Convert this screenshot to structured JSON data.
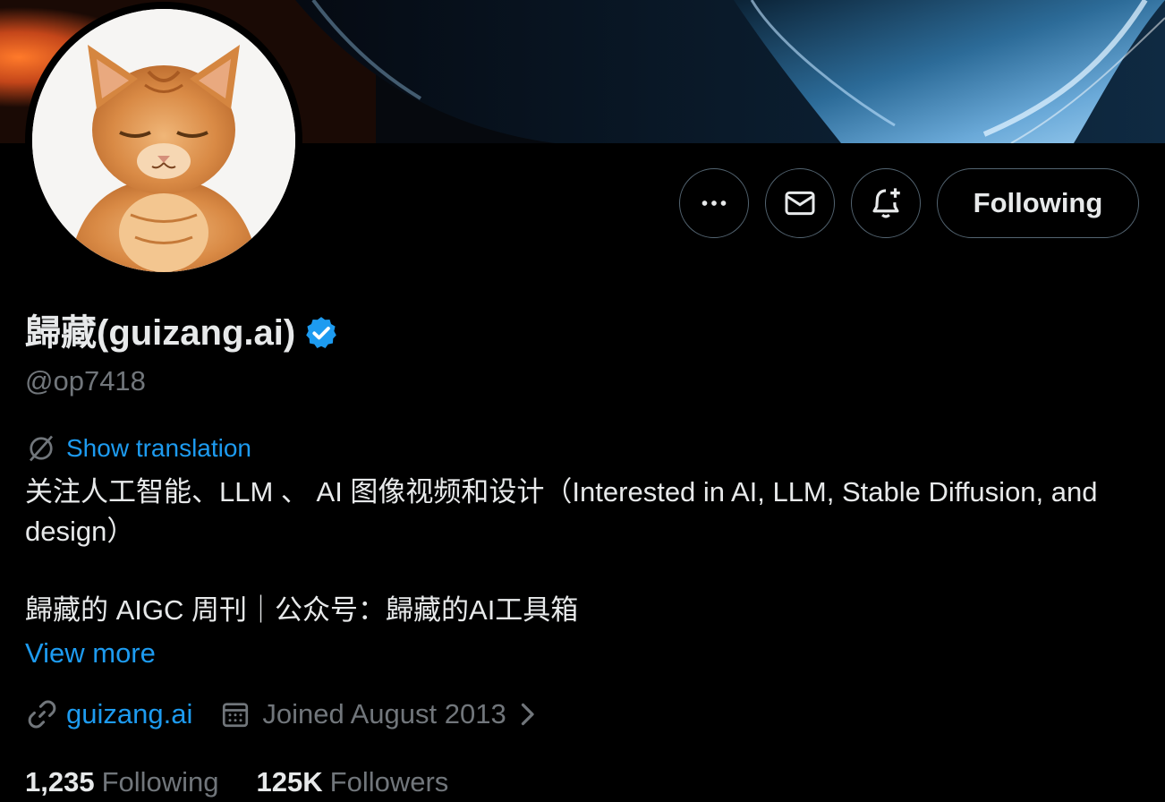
{
  "profile": {
    "display_name": "歸藏(guizang.ai)",
    "handle": "@op7418",
    "verified_icon": "verified-badge-icon",
    "verified_color": "#1d9bf0"
  },
  "actions": {
    "more_icon": "more-horizontal-icon",
    "message_icon": "mail-icon",
    "notify_icon": "bell-plus-icon",
    "following_label": "Following"
  },
  "translation": {
    "icon": "translate-icon",
    "label": "Show translation"
  },
  "bio": {
    "line1": "关注人工智能、LLM 、 AI 图像视频和设计（Interested in AI, LLM, Stable Diffusion, and design）",
    "line2": "歸藏的 AIGC 周刊｜公众号：歸藏的AI工具箱",
    "view_more": "View more"
  },
  "meta": {
    "link_icon": "link-icon",
    "website": "guizang.ai",
    "calendar_icon": "calendar-icon",
    "joined": "Joined August 2013",
    "chevron_icon": "chevron-right-icon"
  },
  "stats": {
    "following_count": "1,235",
    "following_label": "Following",
    "followers_count": "125K",
    "followers_label": "Followers"
  },
  "colors": {
    "accent": "#1d9bf0",
    "text_primary": "#e7e9ea",
    "text_secondary": "#71767b",
    "border": "#536471",
    "background": "#000000"
  }
}
